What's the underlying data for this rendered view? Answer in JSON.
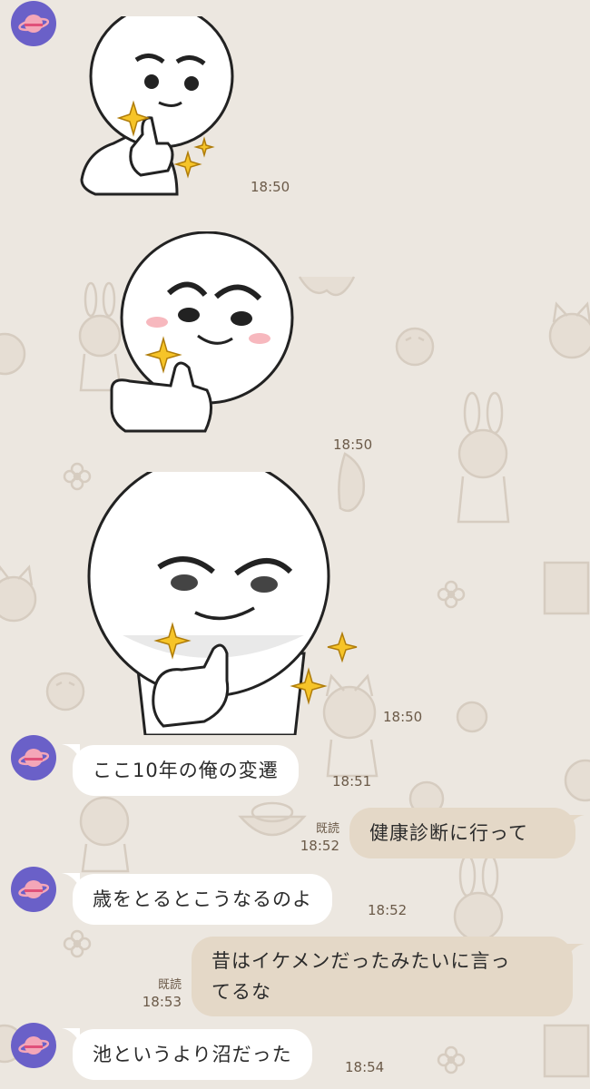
{
  "chat": {
    "background_color": "#ece7e0",
    "incoming_bubble_color": "#ffffff",
    "outgoing_bubble_color": "#e4d8c7",
    "avatar_color": "#6a60c8",
    "avatar_icon": "planet-icon",
    "messages": [
      {
        "type": "sticker",
        "sender": "other",
        "sticker": "thumbs-up-face-sticker-1",
        "time": "18:50"
      },
      {
        "type": "sticker",
        "sender": "other",
        "sticker": "thumbs-up-face-sticker-2",
        "time": "18:50"
      },
      {
        "type": "sticker",
        "sender": "other",
        "sticker": "thumbs-up-face-sticker-3",
        "time": "18:50"
      },
      {
        "type": "text",
        "sender": "other",
        "text": "ここ10年の俺の変遷",
        "time": "18:51"
      },
      {
        "type": "text",
        "sender": "me",
        "text": "健康診断に行って",
        "time": "18:52",
        "status": "既読"
      },
      {
        "type": "text",
        "sender": "other",
        "text": "歳をとるとこうなるのよ",
        "time": "18:52"
      },
      {
        "type": "text",
        "sender": "me",
        "text_line1": "昔はイケメンだったみたいに言っ",
        "text_line2": "てるな",
        "time": "18:53",
        "status": "既読"
      },
      {
        "type": "text",
        "sender": "other",
        "text": "池というより沼だった",
        "time": "18:54"
      }
    ]
  }
}
